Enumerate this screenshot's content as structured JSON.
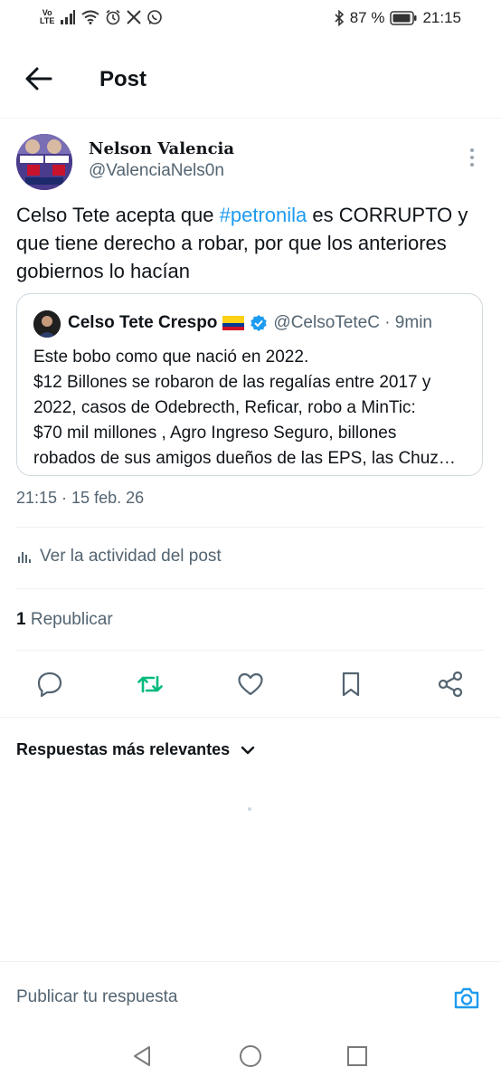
{
  "status_bar": {
    "volte_top": "Vo",
    "volte_bottom": "LTE",
    "battery": "87 %",
    "time": "21:15"
  },
  "header": {
    "title": "Post"
  },
  "post": {
    "author_name": "Nelson Valencia",
    "author_handle": "@ValenciaNels0n",
    "text_before": "Celso Tete acepta que ",
    "hashtag": "#petronila",
    "text_after": " es CORRUPTO y  que tiene derecho a robar, por que los anteriores gobiernos lo hacían",
    "timestamp": "21:15 · 15 feb. 26",
    "activity_label": "Ver la actividad del post",
    "repost_count": "1",
    "repost_label": "Republicar"
  },
  "quote": {
    "name": "Celso Tete Crespo",
    "handle_time": "@CelsoTeteC · 9min",
    "lines": [
      "Este bobo como que nació en 2022.",
      "$12 Billones se robaron de las regalías entre 2017 y",
      "2022, casos de Odebrecth, Reficar, robo a MinTic:",
      "$70 mil millones , Agro Ingreso Seguro, billones",
      "robados de sus amigos  dueños de las EPS, las Chuz…"
    ]
  },
  "replies": {
    "sort_label": "Respuestas más relevantes"
  },
  "reply_bar": {
    "placeholder": "Publicar tu respuesta"
  },
  "colors": {
    "accent": "#1d9bf0",
    "repost_active": "#00ba7c",
    "muted": "#536471"
  },
  "icons": [
    "back-arrow-icon",
    "more-vertical-icon",
    "verified-badge-icon",
    "flag-colombia-icon",
    "stats-icon",
    "reply-icon",
    "repost-icon",
    "like-icon",
    "bookmark-icon",
    "share-icon",
    "chevron-down-icon",
    "camera-icon",
    "nav-back-icon",
    "nav-home-icon",
    "nav-recents-icon"
  ]
}
